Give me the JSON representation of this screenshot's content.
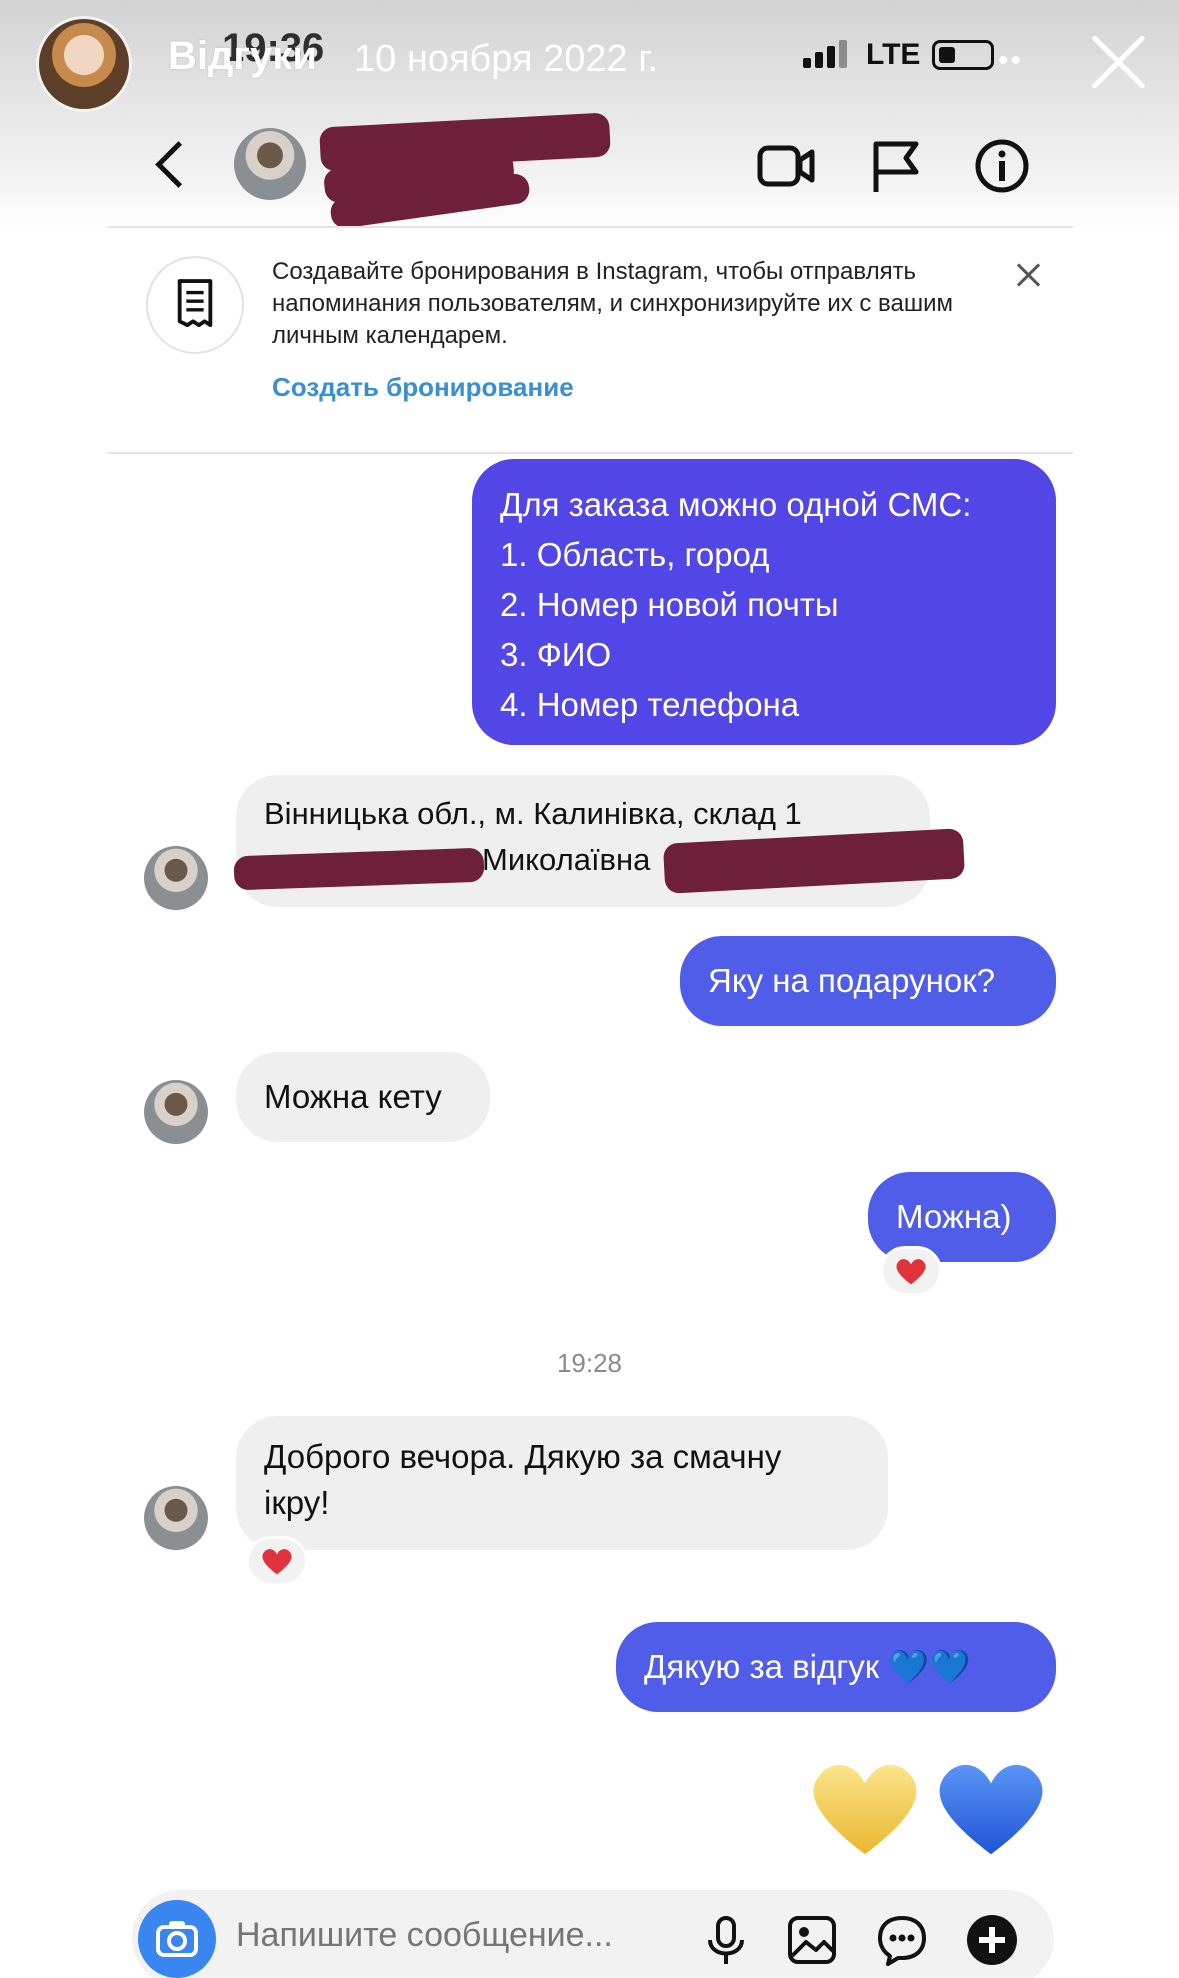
{
  "story": {
    "title": "Відгуки",
    "clock": "19:36",
    "date": "10 ноября 2022 г.",
    "network": "LTE"
  },
  "chat_header": {
    "contact_name": ""
  },
  "banner": {
    "text": "Создавайте бронирования в Instagram, чтобы отправлять напоминания пользователям, и синхронизируйте их с вашим личным календарем.",
    "link": "Создать бронирование"
  },
  "messages": {
    "m1": {
      "line1": "Для заказа можно одной СМС:",
      "line2": "1. Область, город",
      "line3": "2. Номер новой почты",
      "line4": "3. ФИО",
      "line5": "4. Номер телефона"
    },
    "m2": {
      "line1": "Вінницька обл., м. Калинівка, склад 1",
      "line2": "Миколаївна"
    },
    "m3": "Яку на подарунок?",
    "m4": "Можна кету",
    "m5": "Можна)",
    "timestamp": "19:28",
    "m6": {
      "line1": "Доброго вечора. Дякую за смачну",
      "line2": "ікру!"
    },
    "m7": "Дякую за відгук 💙💙"
  },
  "composer": {
    "placeholder": "Напишите сообщение..."
  },
  "colors": {
    "outgoing_purple": "#5246e6",
    "outgoing_blue": "#4f5de8",
    "incoming_gray": "#efefef",
    "link_blue": "#3a8fd1",
    "heart_red": "#e0333b",
    "heart_yellow": "#f2c94c",
    "heart_blue": "#2f6fe4"
  },
  "icons": [
    "back-icon",
    "video-call-icon",
    "flag-icon",
    "info-icon",
    "receipt-icon",
    "close-icon",
    "camera-icon",
    "microphone-icon",
    "gallery-icon",
    "sticker-icon",
    "plus-icon",
    "red-heart-icon",
    "yellow-heart-icon",
    "blue-heart-icon"
  ]
}
